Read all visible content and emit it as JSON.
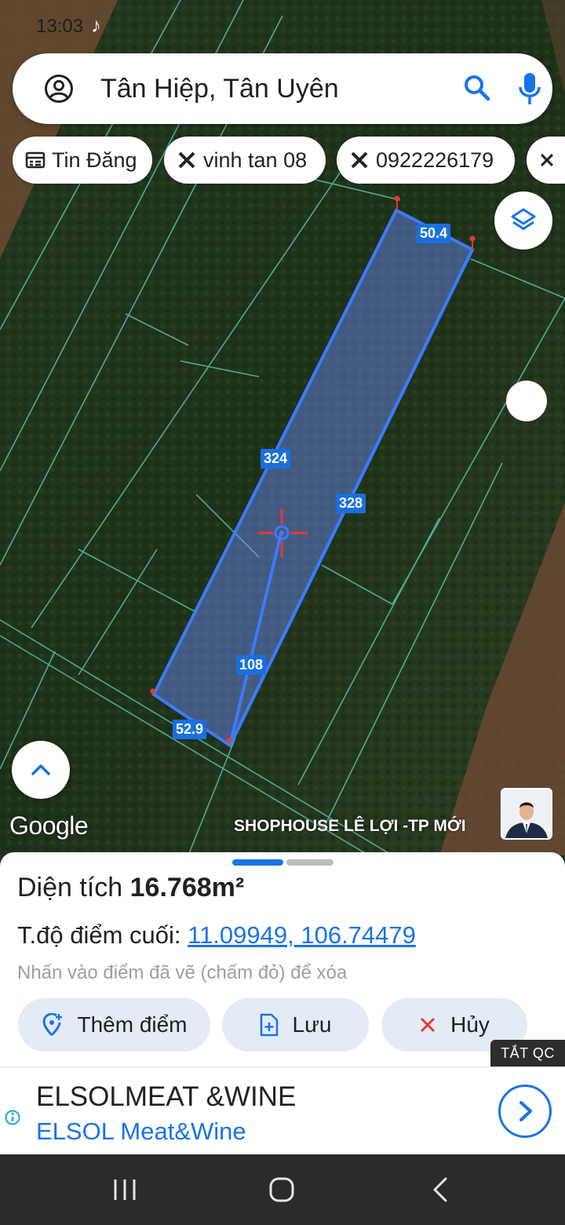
{
  "status_bar": {
    "time": "13:03"
  },
  "search": {
    "query": "Tân Hiệp, Tân Uyên"
  },
  "chips": [
    {
      "label": "Tin Đăng",
      "icon": "list-icon"
    },
    {
      "label": "vinh tan 08",
      "icon": "tools-icon"
    },
    {
      "label": "0922226179",
      "icon": "tools-icon"
    },
    {
      "label": "",
      "icon": "tools-icon"
    }
  ],
  "map": {
    "measurements": {
      "top_edge": "50.4",
      "left_edge": "324",
      "right_edge": "328",
      "inner_line": "108",
      "bottom_edge": "52.9"
    },
    "attribution": "Google",
    "overlay_title": "SHOPHOUSE LÊ LỢI -TP MỚI"
  },
  "sheet": {
    "area_label": "Diện tích",
    "area_value": "16.768m²",
    "coord_label": "T.độ điểm cuối:",
    "coord_value": "11.09949, 106.74479",
    "hint": "Nhấn vào điểm đã vẽ (chấm đỏ) để xóa",
    "buttons": {
      "add_point": "Thêm điểm",
      "save": "Lưu",
      "cancel": "Hủy"
    }
  },
  "ad": {
    "close_label": "TẮT QC",
    "title": "ELSOLMEAT &WINE",
    "subtitle": "ELSOL Meat&Wine"
  },
  "colors": {
    "accent": "#1a73e8",
    "polygon": "#3b7bff",
    "marker_red": "#e53935"
  }
}
